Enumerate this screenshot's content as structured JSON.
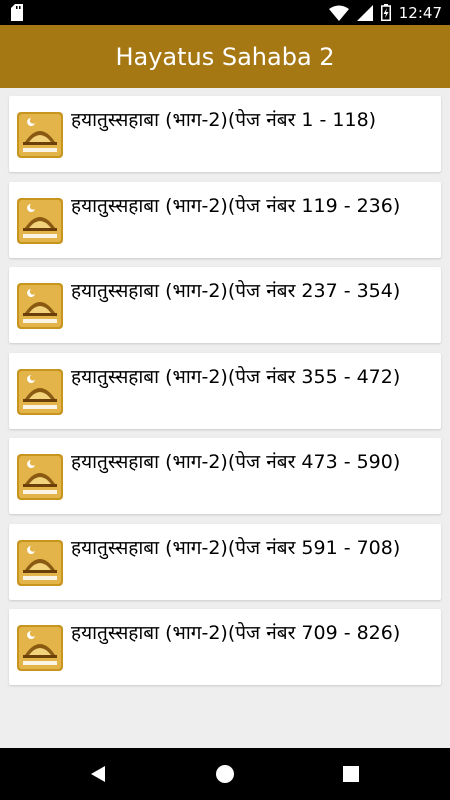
{
  "status_bar": {
    "time": "12:47",
    "icons": [
      "sd-card-icon",
      "wifi-icon",
      "signal-icon",
      "battery-charging-icon"
    ]
  },
  "app_bar": {
    "title": "Hayatus Sahaba 2"
  },
  "list": {
    "items": [
      {
        "title": "हयातुस्सहाबा (भाग-2)(पेज नंबर 1 - 118)",
        "icon": "book-cover-icon"
      },
      {
        "title": "हयातुस्सहाबा (भाग-2)(पेज नंबर 119 - 236)",
        "icon": "book-cover-icon"
      },
      {
        "title": "हयातुस्सहाबा (भाग-2)(पेज नंबर 237 - 354)",
        "icon": "book-cover-icon"
      },
      {
        "title": "हयातुस्सहाबा (भाग-2)(पेज नंबर 355 - 472)",
        "icon": "book-cover-icon"
      },
      {
        "title": "हयातुस्सहाबा (भाग-2)(पेज नंबर 473 - 590)",
        "icon": "book-cover-icon"
      },
      {
        "title": "हयातुस्सहाबा (भाग-2)(पेज नंबर 591 - 708)",
        "icon": "book-cover-icon"
      },
      {
        "title": "हयातुस्सहाबा (भाग-2)(पेज नंबर 709 - 826)",
        "icon": "book-cover-icon"
      }
    ]
  },
  "nav_bar": {
    "buttons": [
      "back-icon",
      "home-icon",
      "recents-icon"
    ]
  },
  "colors": {
    "app_bar": "#a67814",
    "background": "#eeeeee",
    "card": "#ffffff",
    "status_bar": "#000000"
  }
}
